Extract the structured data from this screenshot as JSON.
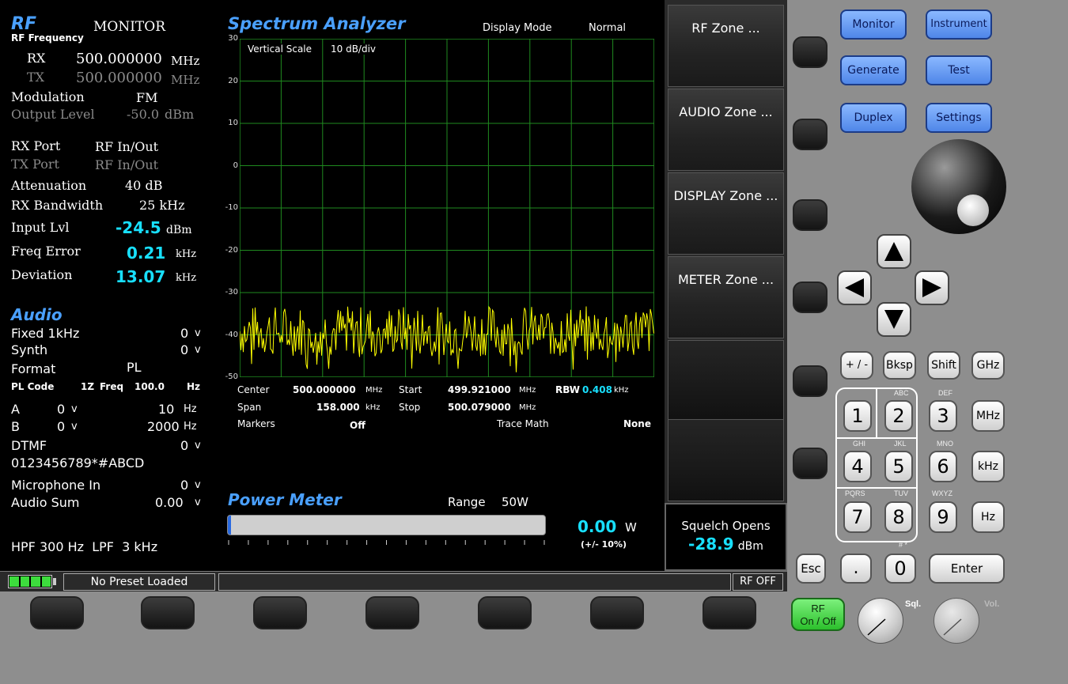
{
  "rf": {
    "title": "RF",
    "mode": "MONITOR",
    "freq_header": "RF Frequency",
    "rx_label": "RX",
    "rx_value": "500.000000",
    "rx_unit": "MHz",
    "tx_label": "TX",
    "tx_value": "500.000000",
    "tx_unit": "MHz",
    "mod_label": "Modulation",
    "mod_value": "FM",
    "out_label": "Output Level",
    "out_value": "-50.0",
    "out_unit": "dBm",
    "rxport_label": "RX Port",
    "rxport_value": "RF In/Out",
    "txport_label": "TX Port",
    "txport_value": "RF In/Out",
    "atten_label": "Attenuation",
    "atten_value": "40 dB",
    "rxbw_label": "RX Bandwidth",
    "rxbw_value": "25 kHz",
    "inlvl_label": "Input Lvl",
    "inlvl_value": "-24.5",
    "inlvl_unit": "dBm",
    "ferr_label": "Freq Error",
    "ferr_value": "0.21",
    "ferr_unit": "kHz",
    "dev_label": "Deviation",
    "dev_value": "13.07",
    "dev_unit": "kHz"
  },
  "audio": {
    "title": "Audio",
    "fixed_label": "Fixed 1kHz",
    "fixed_value": "0",
    "fixed_unit": "v",
    "synth_label": "Synth",
    "synth_value": "0",
    "synth_unit": "v",
    "format_label": "Format",
    "format_value": "PL",
    "plcode_label": "PL Code",
    "plcode_value": "1Z",
    "plfreq_label": "Freq",
    "plfreq_value": "100.0",
    "plfreq_unit": "Hz",
    "a_label": "A",
    "a_value": "0",
    "a_unit": "v",
    "a_freq": "10",
    "a_freq_unit": "Hz",
    "b_label": "B",
    "b_value": "0",
    "b_unit": "v",
    "b_freq": "2000",
    "b_freq_unit": "Hz",
    "dtmf_label": "DTMF",
    "dtmf_value": "0",
    "dtmf_unit": "v",
    "dtmf_digits": "0123456789*#ABCD",
    "mic_label": "Microphone In",
    "mic_value": "0",
    "mic_unit": "v",
    "sum_label": "Audio Sum",
    "sum_value": "0.00",
    "sum_unit": "v",
    "filters": "HPF 300 Hz  LPF  3 kHz"
  },
  "spectrum": {
    "title": "Spectrum Analyzer",
    "display_mode_label": "Display Mode",
    "display_mode_value": "Normal",
    "vscale_label": "Vertical Scale",
    "vscale_value": "10 dB/div",
    "y_ticks": [
      "30",
      "20",
      "10",
      "0",
      "-10",
      "-20",
      "-30",
      "-40",
      "-50"
    ],
    "center_label": "Center",
    "center_value": "500.000000",
    "center_unit": "MHz",
    "start_label": "Start",
    "start_value": "499.921000",
    "start_unit": "MHz",
    "rbw_label": "RBW",
    "rbw_value": "0.408",
    "rbw_unit": "kHz",
    "span_label": "Span",
    "span_value": "158.000",
    "span_unit": "kHz",
    "stop_label": "Stop",
    "stop_value": "500.079000",
    "stop_unit": "MHz",
    "markers_label": "Markers",
    "markers_value": "Off",
    "tracemath_label": "Trace Math",
    "tracemath_value": "None",
    "trace_color": "#ffff00",
    "grid_color": "#1f8a1f"
  },
  "power": {
    "title": "Power Meter",
    "range_label": "Range",
    "range_value": "50W",
    "value": "0.00",
    "unit": "W",
    "tolerance": "(+/- 10%)",
    "fill_fraction": 0.01
  },
  "softkeys": [
    {
      "label": "RF Zone ..."
    },
    {
      "label": "AUDIO Zone ..."
    },
    {
      "label": "DISPLAY Zone ..."
    },
    {
      "label": "METER Zone ..."
    },
    {
      "label": ""
    },
    {
      "label": ""
    }
  ],
  "squelch": {
    "label": "Squelch Opens",
    "value": "-28.9",
    "unit": "dBm"
  },
  "status": {
    "preset": "No Preset Loaded",
    "message": "",
    "rf_state": "RF OFF"
  },
  "mode_buttons": {
    "monitor": "Monitor",
    "instrument": "Instrument",
    "generate": "Generate",
    "test": "Test",
    "duplex": "Duplex",
    "settings": "Settings"
  },
  "keypad": {
    "plusminus": "+ / -",
    "bksp": "Bksp",
    "shift": "Shift",
    "ghz": "GHz",
    "mhz": "MHz",
    "khz": "kHz",
    "hz": "Hz",
    "k1": "1",
    "k2": "2",
    "k3": "3",
    "k4": "4",
    "k5": "5",
    "k6": "6",
    "k7": "7",
    "k8": "8",
    "k9": "9",
    "k0": "0",
    "dot": ".",
    "s2": "ABC",
    "s3": "DEF",
    "s4": "GHI",
    "s5": "JKL",
    "s6": "MNO",
    "s7": "PQRS",
    "s8": "TUV",
    "s9": "WXYZ",
    "s0": "# *",
    "esc": "Esc",
    "enter": "Enter"
  },
  "rf_toggle": {
    "line1": "RF",
    "line2": "On / Off"
  },
  "knobs": {
    "sql": "Sql.",
    "vol": "Vol."
  },
  "colors": {
    "accent_blue": "#4aa0ff",
    "readout_cyan": "#18e0ff",
    "trace_yellow": "#ffff00",
    "grid_green": "#1f8a1f",
    "rf_green": "#3ddc3d"
  }
}
